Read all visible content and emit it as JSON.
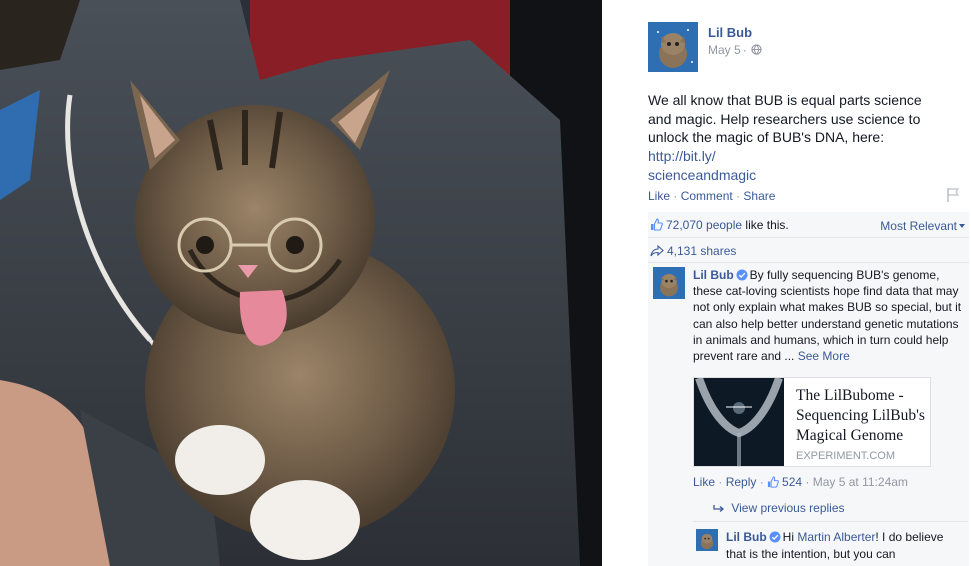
{
  "post": {
    "page_name": "Lil Bub",
    "date": "May 5",
    "text": "We all know that BUB is equal parts science and magic. Help researchers use science to unlock the magic of BUB's DNA, here: ",
    "link_text": "http://bit.ly/scienceandmagic",
    "link_text_line1": "http://bit.ly/",
    "link_text_line2": "scienceandmagic"
  },
  "actions": {
    "like": "Like",
    "comment": "Comment",
    "share": "Share"
  },
  "stats": {
    "likes_count": "72,070 people",
    "likes_suffix": " like this.",
    "sort_label": "Most Relevant",
    "shares": "4,131 shares"
  },
  "comment": {
    "author": "Lil Bub",
    "text": "By fully sequencing BUB's genome, these cat-loving scientists hope find data that may not only explain what makes BUB so special, but it can also help better understand genetic mutations in animals and humans, which in turn could help prevent rare and ... ",
    "see_more": "See More",
    "link_card": {
      "title": "The LilBubome - Sequencing LilBub's Magical Genome",
      "domain": "EXPERIMENT.COM"
    },
    "like": "Like",
    "reply": "Reply",
    "like_count": "524",
    "timestamp": "May 5 at 11:24am",
    "view_previous": "View previous replies"
  },
  "reply": {
    "author": "Lil Bub",
    "greeting": "Hi ",
    "mention": "Martin Alberter",
    "text": "! I do believe that is the intention, but you can"
  },
  "colors": {
    "link_blue": "#3b5998",
    "meta_gray": "#9197a3",
    "ufi_bg": "#f6f7f8"
  },
  "icons": [
    "globe-icon",
    "flag-icon",
    "like-thumb-icon",
    "share-arrow-icon",
    "verified-badge-icon",
    "reply-arrow-icon"
  ]
}
